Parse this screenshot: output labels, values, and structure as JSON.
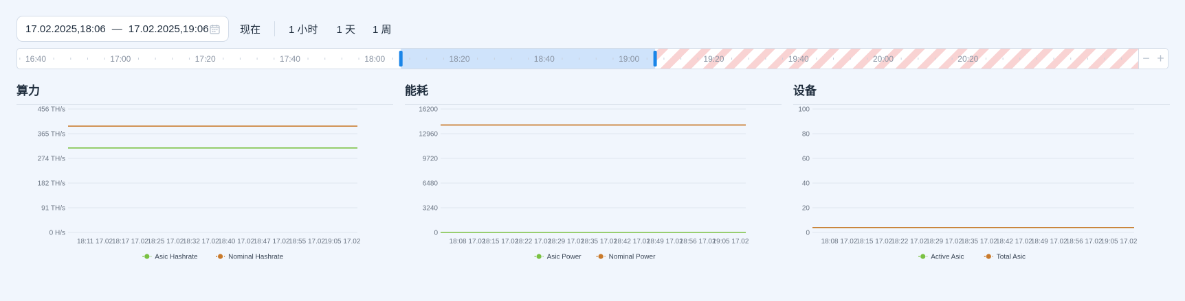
{
  "toolbar": {
    "date_from": "17.02.2025,18:06",
    "date_sep": "—",
    "date_to": "17.02.2025,19:06",
    "calendar_icon": "calendar-icon",
    "presets": [
      "现在",
      "1 小时",
      "1 天",
      "1 周"
    ]
  },
  "timeline": {
    "labels": [
      "16:40",
      "17:00",
      "17:20",
      "17:40",
      "18:00",
      "18:20",
      "18:40",
      "19:00",
      "19:20",
      "19:40",
      "20:00",
      "20:20"
    ],
    "selection_start": "18:06",
    "selection_end": "19:06",
    "zoom_out": "−",
    "zoom_in": "+",
    "colors": {
      "selection": "#cfe3fb",
      "handle": "#1a85e8",
      "future_stripe": "#f9d3d3"
    }
  },
  "panels": [
    {
      "title": "算力",
      "legend": [
        "Asic Hashrate",
        "Nominal Hashrate"
      ]
    },
    {
      "title": "能耗",
      "legend": [
        "Asic Power",
        "Nominal Power"
      ]
    },
    {
      "title": "设备",
      "legend": [
        "Active Asic",
        "Total Asic"
      ]
    }
  ],
  "colors": {
    "green": "#7ac142",
    "orange": "#c97a2b",
    "grid": "#e0e6ef",
    "tick_text": "#6b7583"
  },
  "chart_data": [
    {
      "type": "line",
      "title": "算力",
      "y_ticks": [
        "0 H/s",
        "91 TH/s",
        "182 TH/s",
        "274 TH/s",
        "365 TH/s",
        "456 TH/s"
      ],
      "ylim": [
        0,
        456
      ],
      "x": [
        "18:11 17.02",
        "18:17 17.02",
        "18:25 17.02",
        "18:32 17.02",
        "18:40 17.02",
        "18:47 17.02",
        "18:55 17.02",
        "19:05 17.02"
      ],
      "series": [
        {
          "name": "Asic Hashrate",
          "color": "#7ac142",
          "values": [
            312,
            312,
            312,
            312,
            312,
            312,
            312,
            312
          ]
        },
        {
          "name": "Nominal Hashrate",
          "color": "#c97a2b",
          "values": [
            393,
            393,
            393,
            393,
            393,
            393,
            393,
            393
          ]
        }
      ]
    },
    {
      "type": "line",
      "title": "能耗",
      "y_ticks": [
        "0",
        "3240",
        "6480",
        "9720",
        "12960",
        "16200"
      ],
      "ylim": [
        0,
        16200
      ],
      "x": [
        "18:08 17.02",
        "18:15 17.02",
        "18:22 17.02",
        "18:29 17.02",
        "18:35 17.02",
        "18:42 17.02",
        "18:49 17.02",
        "18:56 17.02",
        "19:05 17.02"
      ],
      "series": [
        {
          "name": "Asic Power",
          "color": "#7ac142",
          "values": [
            0,
            0,
            0,
            0,
            0,
            0,
            0,
            0,
            0
          ]
        },
        {
          "name": "Nominal Power",
          "color": "#c97a2b",
          "values": [
            14100,
            14100,
            14100,
            14100,
            14100,
            14100,
            14100,
            14100,
            14100
          ]
        }
      ]
    },
    {
      "type": "line",
      "title": "设备",
      "y_ticks": [
        "0",
        "20",
        "40",
        "60",
        "80",
        "100"
      ],
      "ylim": [
        0,
        100
      ],
      "x": [
        "18:08 17.02",
        "18:15 17.02",
        "18:22 17.02",
        "18:29 17.02",
        "18:35 17.02",
        "18:42 17.02",
        "18:49 17.02",
        "18:56 17.02",
        "19:05 17.02"
      ],
      "series": [
        {
          "name": "Active Asic",
          "color": "#7ac142",
          "values": [
            4,
            4,
            4,
            4,
            4,
            4,
            4,
            4,
            4
          ]
        },
        {
          "name": "Total Asic",
          "color": "#c97a2b",
          "values": [
            4,
            4,
            4,
            4,
            4,
            4,
            4,
            4,
            4
          ]
        }
      ]
    }
  ]
}
